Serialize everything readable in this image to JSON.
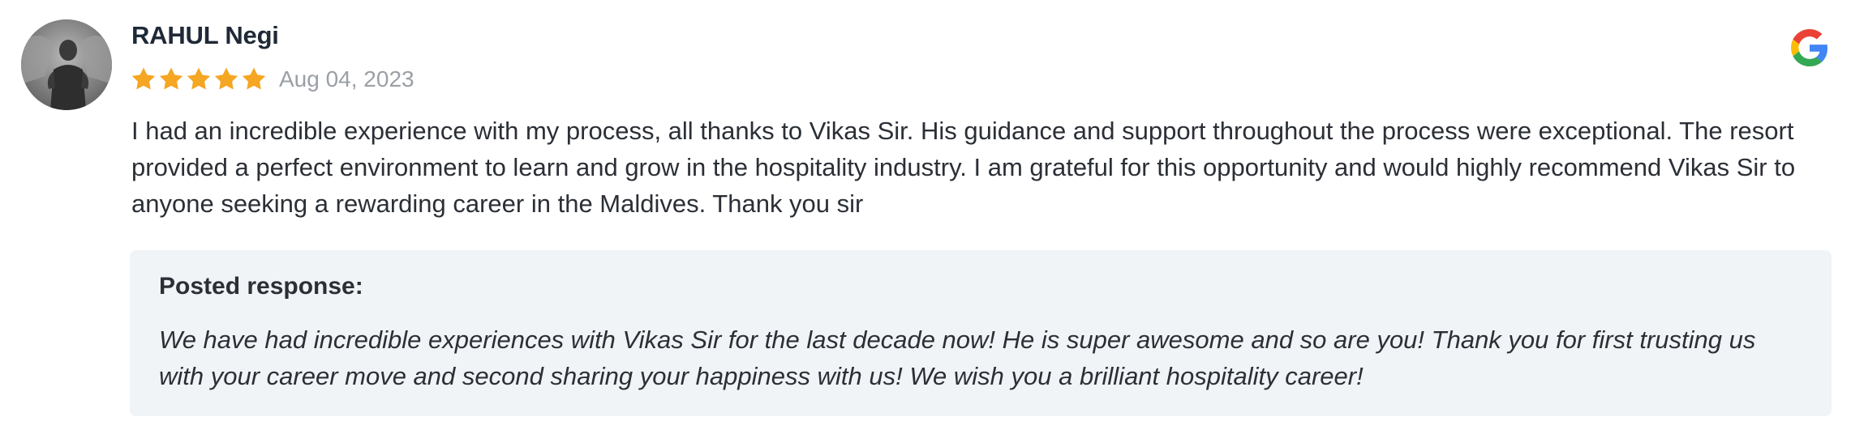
{
  "review": {
    "reviewer_name": "RAHUL Negi",
    "avatar_icon": "reviewer-avatar-photo",
    "rating": 5,
    "rating_max": 5,
    "star_color": "#f5a623",
    "date": "Aug 04, 2023",
    "source_icon": "google-icon",
    "text": "I had an incredible experience with my process, all thanks to Vikas Sir. His guidance and support throughout the process were exceptional. The resort provided a perfect environment to learn and grow in the hospitality industry. I am grateful for this opportunity and would highly recommend Vikas Sir to anyone seeking a rewarding career in the Maldives. Thank you sir"
  },
  "response": {
    "heading": "Posted response:",
    "text": "We have had incredible experiences with Vikas Sir for the last decade now! He is super awesome and so are you! Thank you for first trusting us with your career move and second sharing your happiness with us! We wish you a brilliant hospitality career!",
    "background_color": "#f0f4f7"
  }
}
